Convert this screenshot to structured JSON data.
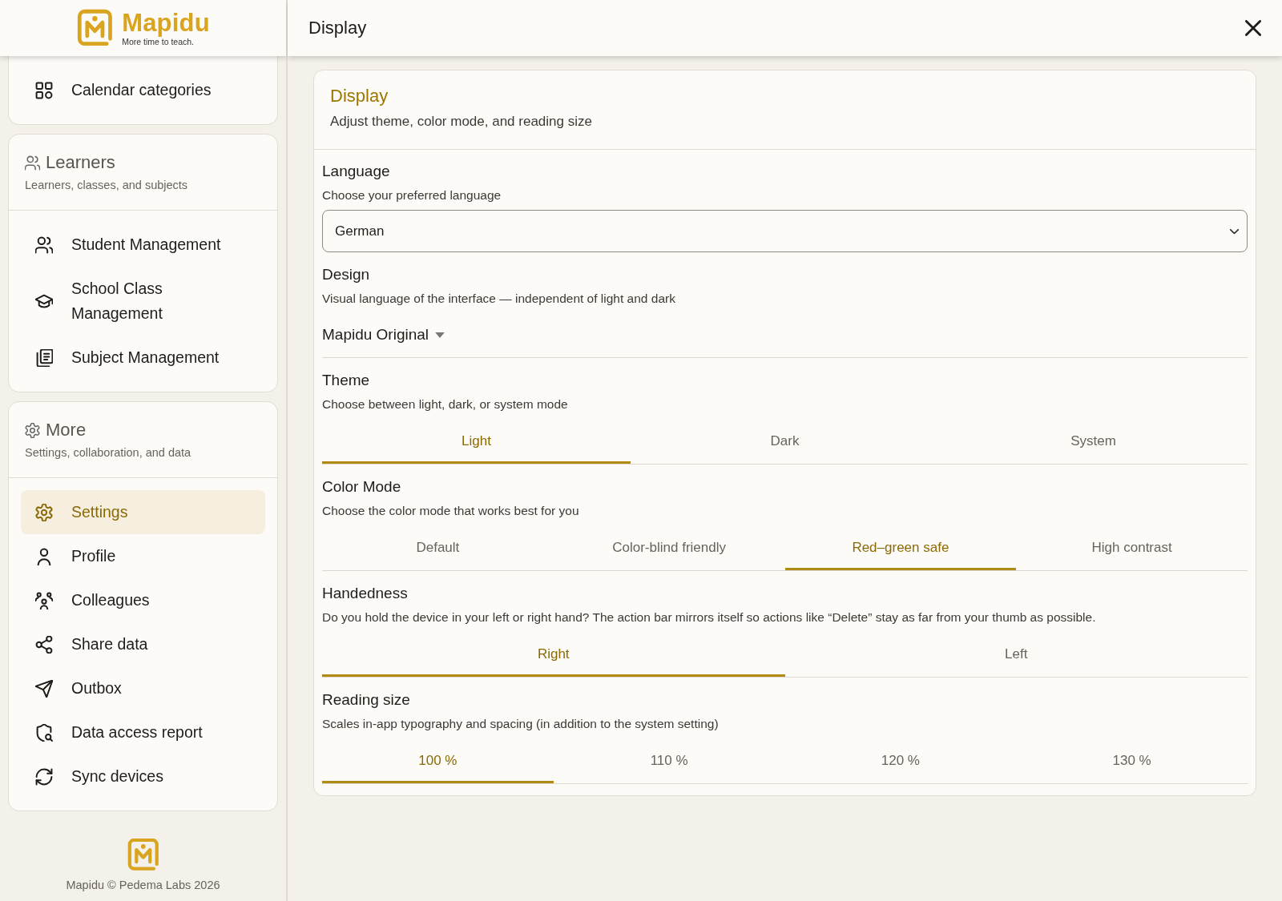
{
  "sidebar": {
    "logo": {
      "name": "Mapidu",
      "tagline": "More time to teach."
    },
    "sections": [
      {
        "items": [
          {
            "label": "Calendar categories",
            "selected": false
          }
        ]
      },
      {
        "title": "Learners",
        "subtitle": "Learners, classes, and subjects",
        "items": [
          {
            "label": "Student Management",
            "selected": false
          },
          {
            "label": "School Class Management",
            "selected": false
          },
          {
            "label": "Subject Management",
            "selected": false
          }
        ]
      },
      {
        "title": "More",
        "subtitle": "Settings, collaboration, and data",
        "items": [
          {
            "label": "Settings",
            "selected": true
          },
          {
            "label": "Profile",
            "selected": false
          },
          {
            "label": "Colleagues",
            "selected": false
          },
          {
            "label": "Share data",
            "selected": false
          },
          {
            "label": "Outbox",
            "selected": false
          },
          {
            "label": "Data access report",
            "selected": false
          },
          {
            "label": "Sync devices",
            "selected": false
          }
        ]
      }
    ],
    "footer": {
      "text": "Mapidu © Pedema Labs 2026"
    }
  },
  "header": {
    "title": "Display"
  },
  "panel": {
    "title": "Display",
    "subtitle": "Adjust theme, color mode, and reading size",
    "settings": [
      {
        "kind": "select",
        "label": "Language",
        "description": "Choose your preferred language",
        "value": "German"
      },
      {
        "kind": "dropdown",
        "label": "Design",
        "description": "Visual language of the interface — independent of light and dark",
        "value": "Mapidu Original"
      },
      {
        "kind": "tabs",
        "label": "Theme",
        "description": "Choose between light, dark, or system mode",
        "options": [
          {
            "label": "Light",
            "selected": true
          },
          {
            "label": "Dark",
            "selected": false
          },
          {
            "label": "System",
            "selected": false
          }
        ]
      },
      {
        "kind": "tabs",
        "label": "Color Mode",
        "description": "Choose the color mode that works best for you",
        "options": [
          {
            "label": "Default",
            "selected": false
          },
          {
            "label": "Color-blind friendly",
            "selected": false
          },
          {
            "label": "Red–green safe",
            "selected": true
          },
          {
            "label": "High contrast",
            "selected": false
          }
        ]
      },
      {
        "kind": "tabs",
        "label": "Handedness",
        "description": "Do you hold the device in your left or right hand? The action bar mirrors itself so actions like “Delete” stay as far from your thumb as possible.",
        "options": [
          {
            "label": "Right",
            "selected": true
          },
          {
            "label": "Left",
            "selected": false
          }
        ]
      },
      {
        "kind": "tabs",
        "label": "Reading size",
        "description": "Scales in-app typography and spacing (in addition to the system setting)",
        "options": [
          {
            "label": "100 %",
            "selected": true
          },
          {
            "label": "110 %",
            "selected": false
          },
          {
            "label": "120 %",
            "selected": false
          },
          {
            "label": "130 %",
            "selected": false
          }
        ]
      }
    ]
  }
}
